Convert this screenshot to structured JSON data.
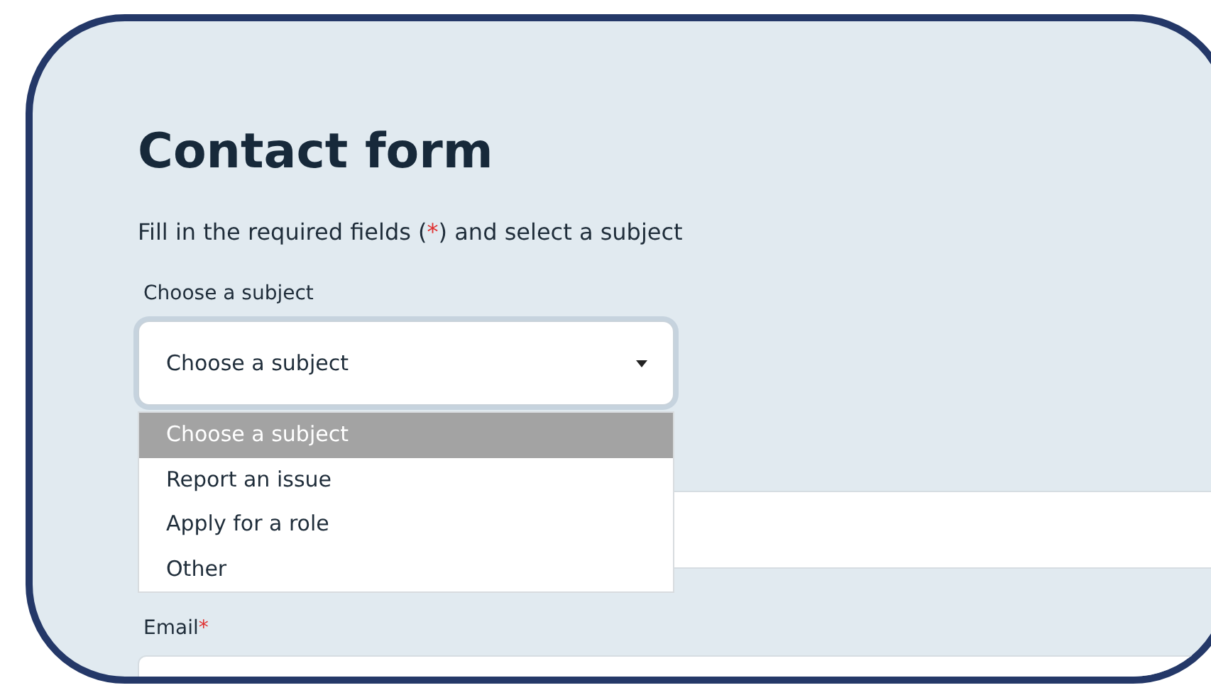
{
  "title": "Contact form",
  "intro": {
    "before": "Fill in the required fields (",
    "marker": "*",
    "after": ") and select a subject"
  },
  "subject": {
    "label": "Choose a subject",
    "value": "Choose a subject",
    "open": true,
    "options": [
      {
        "label": "Choose a subject",
        "selected": true
      },
      {
        "label": "Report an issue",
        "selected": false
      },
      {
        "label": "Apply for a role",
        "selected": false
      },
      {
        "label": "Other",
        "selected": false
      }
    ]
  },
  "fields": [
    {
      "label": "Email",
      "required": true
    }
  ]
}
